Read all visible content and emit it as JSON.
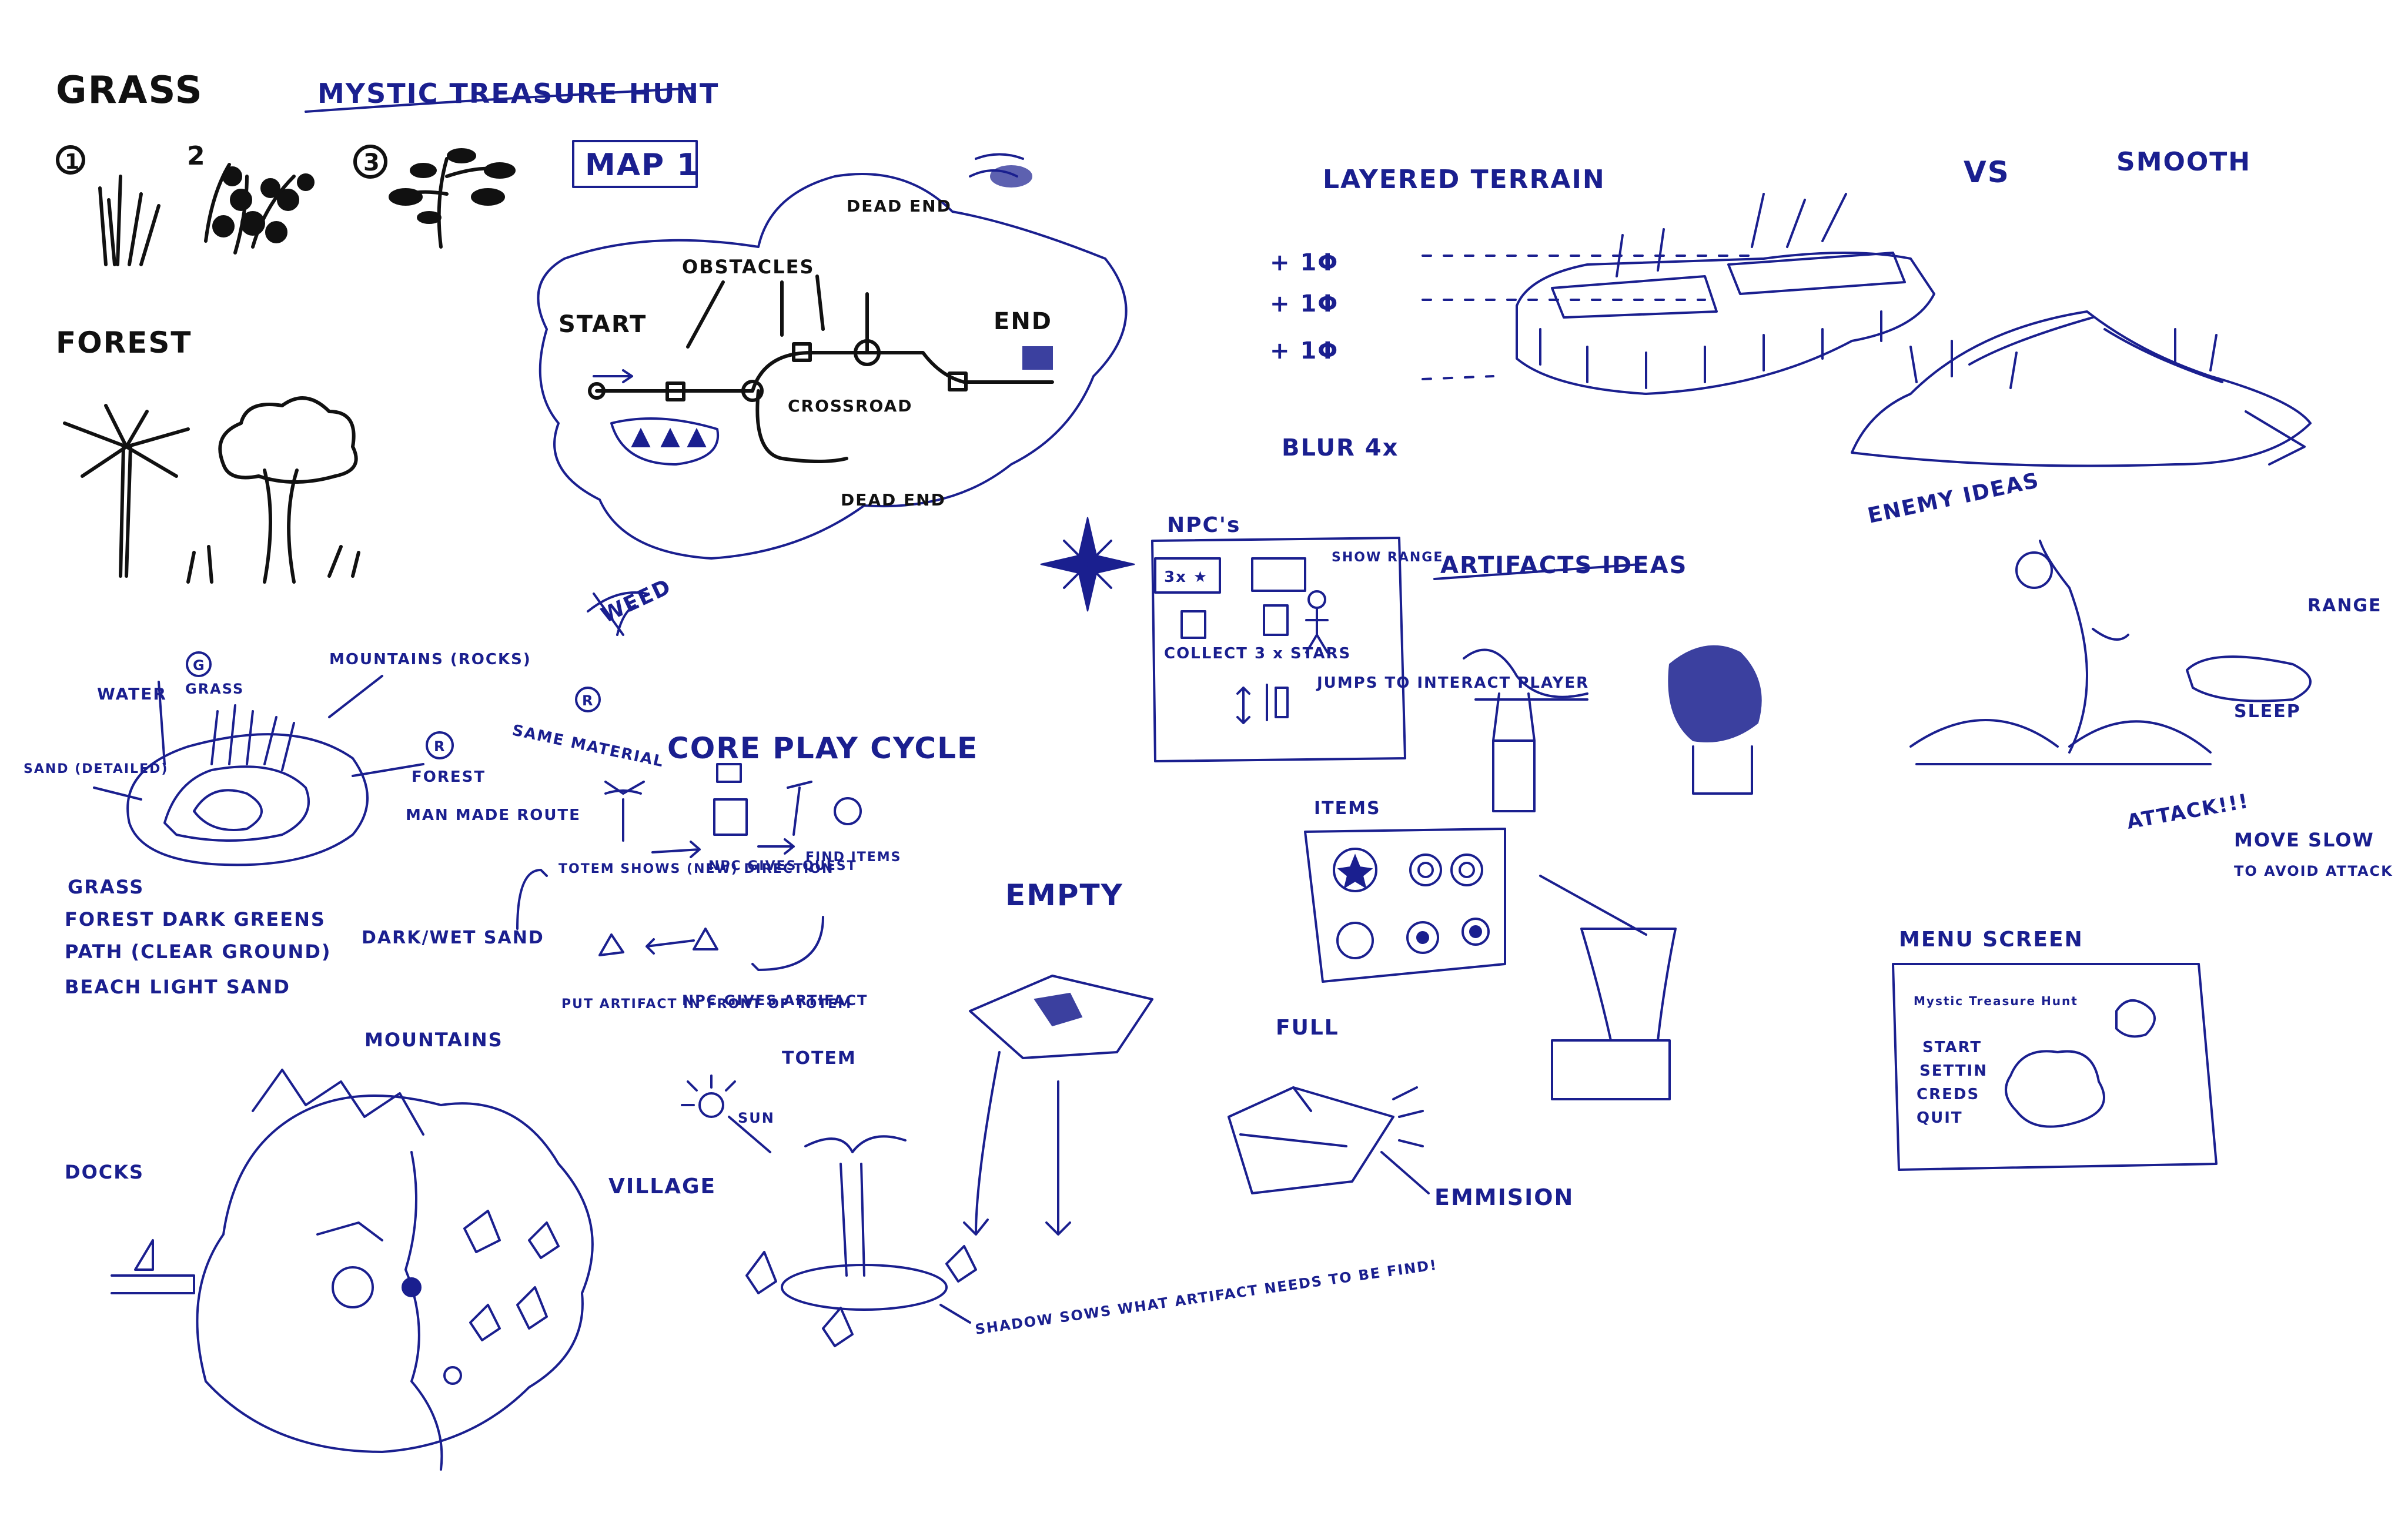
{
  "colors": {
    "ink": "#1a1f8f",
    "pencil": "#111111",
    "paper": "#ffffff"
  },
  "title": "MYSTIC TREASURE HUNT",
  "grass": {
    "heading": "GRASS",
    "variants": [
      "1",
      "2",
      "3"
    ]
  },
  "forest": {
    "heading": "FOREST"
  },
  "map1": {
    "label": "MAP 1",
    "labels": {
      "start": "START",
      "end": "END",
      "obstacles": "OBSTACLES",
      "crossroad": "CROSSROAD",
      "dead_end_top": "DEAD END",
      "dead_end_bottom": "DEAD END"
    }
  },
  "terrain": {
    "layered": "LAYERED TERRAIN",
    "vs": "VS",
    "smooth": "SMOOTH",
    "levels": [
      "+ 1Φ",
      "+ 1Φ",
      "+ 1Φ"
    ],
    "blur": "BLUR 4x"
  },
  "npcs": {
    "heading": "NPC's",
    "collect": "COLLECT 3 x STARS",
    "show_range": "SHOW RANGE",
    "jumps": "JUMPS TO INTERACT PLAYER",
    "bubble": "3x ★"
  },
  "materials": {
    "water": "WATER",
    "grass": "GRASS",
    "grass_marker": "G",
    "mountains": "MOUNTAINS (ROCKS)",
    "mountain_marker": "R",
    "same_material": "SAME MATERIAL",
    "sand": "SAND (DETAILED)",
    "forest": "FOREST",
    "forest_marker": "R",
    "man_made_route": "MAN MADE ROUTE",
    "notes": [
      "GRASS",
      "FOREST DARK GREENS",
      "PATH (CLEAR GROUND)",
      "BEACH    LIGHT SAND"
    ],
    "wet_sand": "DARK/WET SAND",
    "weed": "WEED"
  },
  "play_cycle": {
    "heading": "CORE PLAY CYCLE",
    "steps": [
      "TOTEM SHOWS (NEW) DIRECTION",
      "NPC GIVES QUEST",
      "FIND ITEMS",
      "NPC GIVES ARTIFACT",
      "PUT ARTIFACT IN FRONT OF TOTEM"
    ]
  },
  "artifacts": {
    "heading": "ARTIFACTS IDEAS"
  },
  "items": {
    "heading": "ITEMS"
  },
  "enemy": {
    "heading": "ENEMY IDEAS",
    "range": "RANGE",
    "sleep": "SLEEP",
    "attack": "ATTACK!!!",
    "move_slow": "MOVE SLOW",
    "avoid": "TO AVOID ATTACK"
  },
  "totem_area": {
    "empty": "EMPTY",
    "totem": "TOTEM",
    "sun": "SUN",
    "full": "FULL",
    "emission": "EMMISION",
    "shadow_note": "SHADOW SOWS WHAT ARTIFACT NEEDS TO BE FIND!"
  },
  "village": {
    "mountains": "MOUNTAINS",
    "docks": "DOCKS",
    "village": "VILLAGE"
  },
  "menu": {
    "heading": "MENU SCREEN",
    "game_title": "Mystic Treasure Hunt",
    "options": [
      "START",
      "SETTIN",
      "CREDS",
      "QUIT"
    ]
  }
}
